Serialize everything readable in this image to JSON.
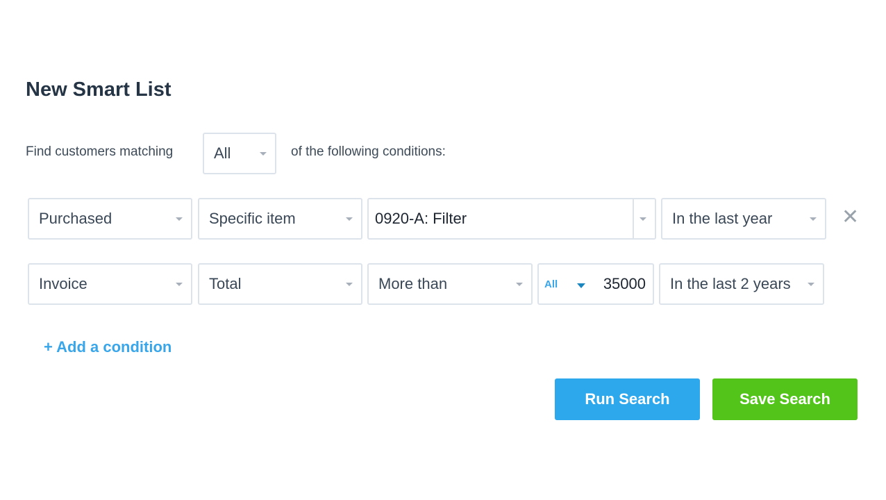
{
  "title": "New Smart List",
  "match": {
    "prefix": "Find customers matching",
    "value": "All",
    "suffix": "of the following conditions:"
  },
  "conditions": [
    {
      "field": "Purchased",
      "type": "Specific item",
      "item": "0920-A: Filter",
      "period": "In the last year"
    },
    {
      "field": "Invoice",
      "type": "Total",
      "comparator": "More than",
      "scope": "All",
      "amount": "35000",
      "period": "In the last 2 years"
    }
  ],
  "add_condition": "+ Add a condition",
  "buttons": {
    "run": "Run Search",
    "save": "Save Search"
  },
  "colors": {
    "run": "#2ea8ec",
    "save": "#52c41a",
    "link": "#3aa6ea"
  }
}
